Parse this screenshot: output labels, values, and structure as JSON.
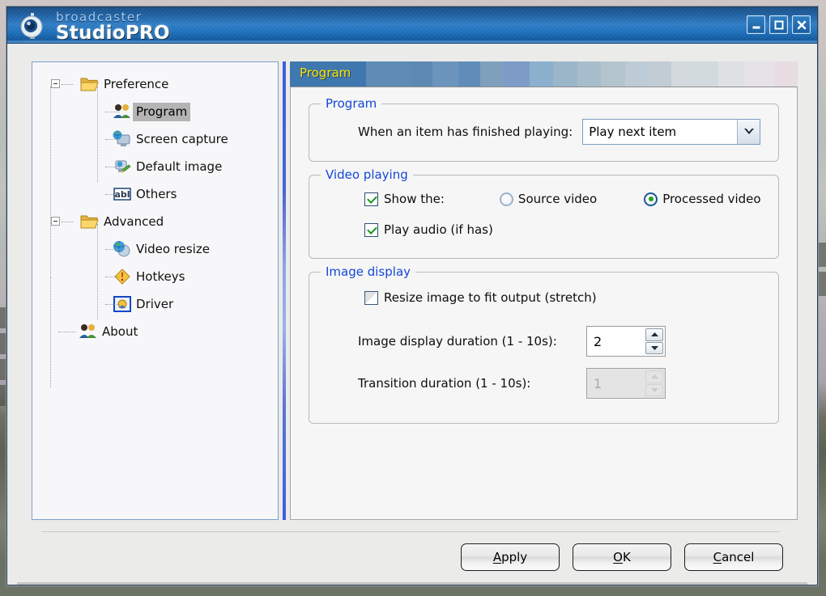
{
  "window": {
    "brand_top": "broadcaster",
    "brand_bottom": "StudioPRO",
    "logo_icon": "webcam-icon",
    "buttons": {
      "minimize": "minimize-icon",
      "maximize": "maximize-icon",
      "close": "close-icon"
    }
  },
  "tree": {
    "nodes": [
      {
        "label": "Preference",
        "level": 0,
        "icon": "folder-open-icon",
        "expander": "minus",
        "selected": false
      },
      {
        "label": "Program",
        "level": 1,
        "icon": "users-icon",
        "expander": "",
        "selected": true
      },
      {
        "label": "Screen capture",
        "level": 1,
        "icon": "globe-monitor-icon",
        "expander": "",
        "selected": false
      },
      {
        "label": "Default image",
        "level": 1,
        "icon": "monitor-brush-icon",
        "expander": "",
        "selected": false
      },
      {
        "label": "Others",
        "level": 1,
        "icon": "abl-textbox-icon",
        "expander": "",
        "selected": false
      },
      {
        "label": "Advanced",
        "level": 0,
        "icon": "folder-open-icon",
        "expander": "minus",
        "selected": false
      },
      {
        "label": "Video resize",
        "level": 1,
        "icon": "globe-icon",
        "expander": "",
        "selected": false
      },
      {
        "label": "Hotkeys",
        "level": 1,
        "icon": "diamond-alert-icon",
        "expander": "",
        "selected": false
      },
      {
        "label": "Driver",
        "level": 1,
        "icon": "driver-gear-icon",
        "expander": "",
        "selected": false
      },
      {
        "label": "About",
        "level": 2,
        "icon": "users-icon",
        "expander": "",
        "selected": false
      }
    ]
  },
  "tab": {
    "active_label": "Program",
    "active_color": "#ffe400",
    "active_bg": "#3f78ae",
    "band_colors": [
      "#3f78ae",
      "#5e8cb5",
      "#5d89b3",
      "#6b95bd",
      "#5f8cb9",
      "#7fa0bd",
      "#7f9bc8",
      "#8bb0cd",
      "#9cb6c9",
      "#a7bdcb",
      "#b4c4cc",
      "#bccbd5",
      "#c2ccd4",
      "#d3d9dd",
      "#d3dade",
      "#dfe2e4",
      "#e6e2e6",
      "#e8dde2",
      "#ece9ea"
    ]
  },
  "program_group": {
    "label": "Program",
    "finished_label": "When an item has finished playing:",
    "combo": {
      "value": "Play next item",
      "arrow_icon": "chevron-down-icon"
    }
  },
  "video_group": {
    "label": "Video playing",
    "show_the": {
      "label": "Show the:",
      "checked": true
    },
    "source_video": {
      "label": "Source video",
      "selected": false
    },
    "processed_video": {
      "label": "Processed video",
      "selected": true
    },
    "play_audio": {
      "label": "Play audio (if has)",
      "checked": true
    }
  },
  "image_group": {
    "label": "Image display",
    "resize_stretch": {
      "label": "Resize image to fit output (stretch)",
      "checked": false
    },
    "display_duration": {
      "label": "Image display duration (1 - 10s):",
      "value": "2",
      "enabled": true
    },
    "transition_duration": {
      "label": "Transition duration (1 - 10s):",
      "value": "1",
      "enabled": false
    }
  },
  "footer": {
    "apply": {
      "pre": "",
      "accel": "A",
      "post": "pply"
    },
    "ok": {
      "pre": "",
      "accel": "O",
      "post": "K"
    },
    "cancel": {
      "pre": "",
      "accel": "C",
      "post": "ancel"
    }
  }
}
